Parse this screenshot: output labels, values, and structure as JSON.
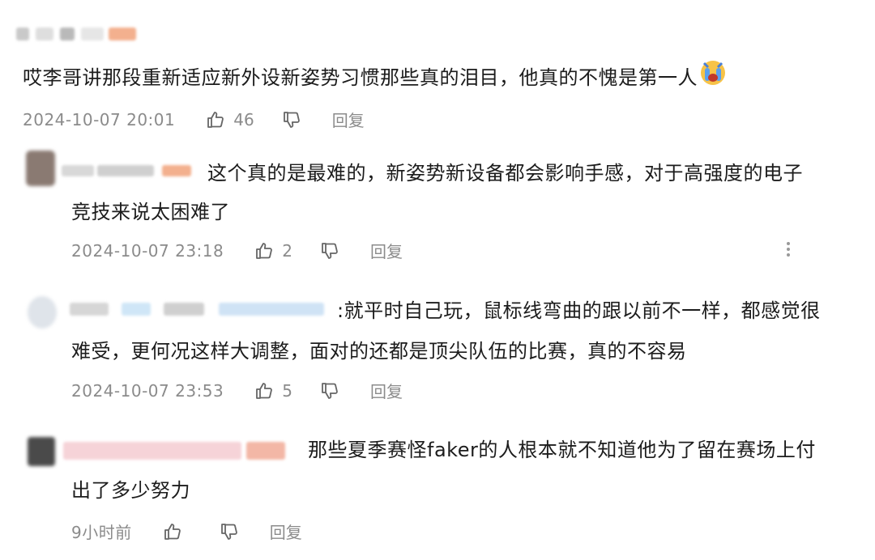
{
  "comments": [
    {
      "text": "哎李哥讲那段重新适应新外设新姿势习惯那些真的泪目，他真的不愧是第一人",
      "time": "2024-10-07 20:01",
      "likes": "46",
      "reply_label": "回复"
    },
    {
      "text_line1": "这个真的是最难的，新姿势新设备都会影响手感，对于高强度的电子",
      "text_line2": "竞技来说太困难了",
      "time": "2024-10-07 23:18",
      "likes": "2",
      "reply_label": "回复"
    },
    {
      "text_line1": ":就平时自己玩，鼠标线弯曲的跟以前不一样，都感觉很",
      "text_line2": "难受，更何况这样大调整，面对的还都是顶尖队伍的比赛，真的不容易",
      "time": "2024-10-07 23:53",
      "likes": "5",
      "reply_label": "回复"
    },
    {
      "text_line1": "那些夏季赛怪faker的人根本就不知道他为了留在赛场上付",
      "text_line2": "出了多少努力",
      "time": "9小时前",
      "reply_label": "回复"
    }
  ],
  "icons": {
    "like": "thumbs-up-icon",
    "dislike": "thumbs-down-icon",
    "more": "more-vertical-icon",
    "emoji": "crying-face-emoji"
  },
  "colors": {
    "text": "#1c1c1c",
    "meta": "#8b8b8b",
    "redacted_accent": "#f0a07a"
  }
}
